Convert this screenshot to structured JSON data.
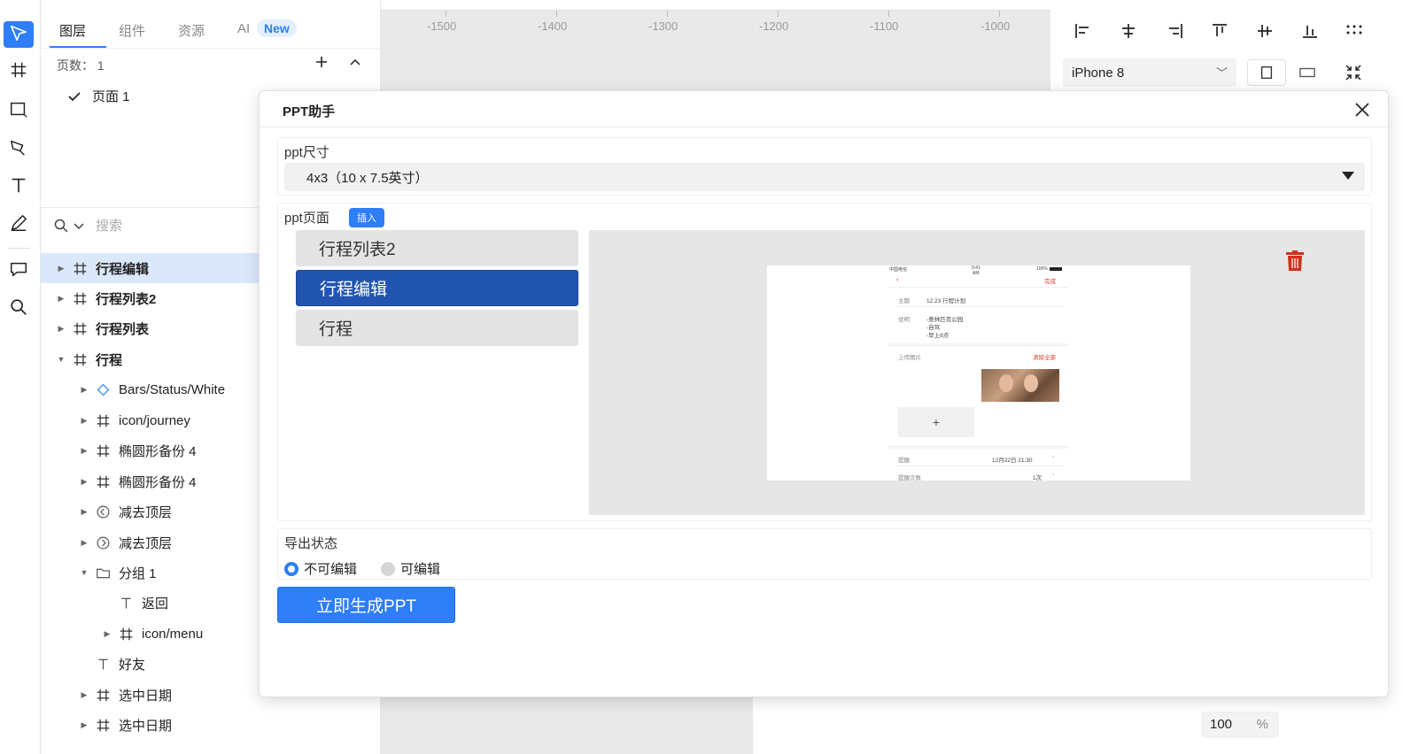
{
  "tabs": [
    "图层",
    "组件",
    "资源",
    "AI"
  ],
  "new_badge": "New",
  "pages": {
    "count_label": "页数： 1",
    "page1": "页面 1"
  },
  "search": {
    "placeholder": "搜索"
  },
  "layers": [
    {
      "label": "行程编辑"
    },
    {
      "label": "行程列表2"
    },
    {
      "label": "行程列表"
    },
    {
      "label": "行程"
    },
    {
      "label": "Bars/Status/White"
    },
    {
      "label": "icon/journey"
    },
    {
      "label": "椭圆形备份 4"
    },
    {
      "label": "椭圆形备份 4"
    },
    {
      "label": "减去顶层"
    },
    {
      "label": "减去顶层"
    },
    {
      "label": "分组 1"
    },
    {
      "label": "返回"
    },
    {
      "label": "icon/menu"
    },
    {
      "label": "好友"
    },
    {
      "label": "选中日期"
    },
    {
      "label": "选中日期"
    }
  ],
  "ruler": [
    "-1500",
    "-1400",
    "-1300",
    "-1200",
    "-1100",
    "-1000"
  ],
  "right_panel": {
    "device": "iPhone 8",
    "percent_value": "100",
    "percent_unit": "%"
  },
  "modal": {
    "title": "PPT助手",
    "size_label": "ppt尺寸",
    "size_value": "4x3（10 x 7.5英寸）",
    "pages_label": "ppt页面",
    "insert_label": "插入",
    "page_items": [
      "行程列表2",
      "行程编辑",
      "行程"
    ],
    "export_label": "导出状态",
    "radio_non_editable": "不可编辑",
    "radio_editable": "可编辑",
    "generate_button": "立即生成PPT"
  },
  "slide_preview": {
    "carrier": "中国电信",
    "time": "9:41",
    "ampm": "AM",
    "battery": "100%",
    "done": "完成",
    "subject_label": "主题",
    "subject_value": "12.23 行程计划",
    "desc_label": "说明",
    "desc_lines": [
      "-奥林匹克公园",
      "-自驾",
      "-早上8点"
    ],
    "upload_label": "上传图片",
    "clear_all": "清除全部",
    "remind_label": "提醒",
    "remind_value": "12月22日 21:30",
    "remind_count_label": "提醒次数",
    "remind_count_value": "1次"
  },
  "colors": {
    "accent": "#2d7ef7",
    "selected_page": "#2255b0",
    "trash": "#d0311c"
  }
}
